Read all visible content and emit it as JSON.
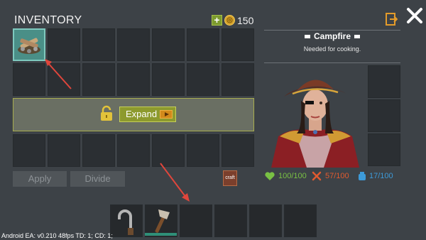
{
  "inventory": {
    "title": "INVENTORY",
    "currency": "150",
    "expand_label": "Expand"
  },
  "actions": {
    "apply": "Apply",
    "divide": "Divide"
  },
  "item_detail": {
    "name": "Campfire",
    "description": "Needed for cooking."
  },
  "stats": {
    "health": "100/100",
    "hunger": "57/100",
    "thirst": "17/100"
  },
  "colors": {
    "health": "#79c144",
    "hunger": "#e05a2f",
    "thirst": "#3d9ad8",
    "selected_slot": "#4a8f87"
  },
  "hotbar": [
    {
      "item": "hook-icon"
    },
    {
      "item": "stone-axe-icon",
      "durability": 1.0
    },
    {
      "item": ""
    },
    {
      "item": ""
    },
    {
      "item": ""
    },
    {
      "item": ""
    }
  ],
  "debug": "Android EA: v0.210 48fps TD: 1; CD: 1;"
}
